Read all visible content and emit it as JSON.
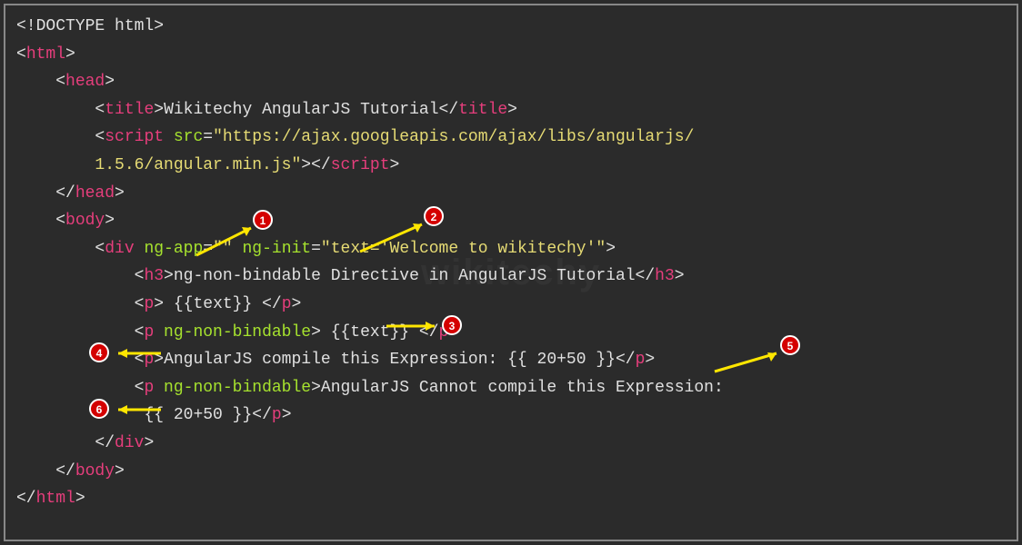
{
  "lines": {
    "l1_open": "<!DOCTYPE html>",
    "l2_open": "<",
    "l2_tag": "html",
    "l2_close": ">",
    "l3_open": "<",
    "l3_tag": "head",
    "l3_close": ">",
    "l4_open": "<",
    "l4_tag": "title",
    "l4_mid": ">",
    "l4_text": "Wikitechy AngularJS Tutorial",
    "l4_close_open": "</",
    "l4_close": ">",
    "l5_open": "<",
    "l5_tag": "script",
    "l5_attr": " src",
    "l5_eq": "=",
    "l5_val": "\"https://ajax.googleapis.com/ajax/libs/angularjs/",
    "l6_val": "1.5.6/angular.min.js\"",
    "l6_mid": ">",
    "l6_close_open": "</",
    "l6_close_tag": "script",
    "l6_close": ">",
    "l7_open": "</",
    "l7_tag": "head",
    "l7_close": ">",
    "l8_open": "<",
    "l8_tag": "body",
    "l8_close": ">",
    "l9_open": "<",
    "l9_tag": "div",
    "l9_attr1": " ng-app",
    "l9_eq1": "=",
    "l9_val1": "\"\"",
    "l9_attr2": " ng-init",
    "l9_eq2": "=",
    "l9_val2": "\"text='Welcome to wikitechy'\"",
    "l9_close": ">",
    "l10_open": "<",
    "l10_tag": "h3",
    "l10_mid": ">",
    "l10_text": "ng-non-bindable Directive in AngularJS Tutorial",
    "l10_close_open": "</",
    "l10_close": ">",
    "l11_open": "<",
    "l11_tag": "p",
    "l11_mid": ">",
    "l11_text": " {{text}} ",
    "l11_close_open": "</",
    "l11_close": ">",
    "l12_open": "<",
    "l12_tag": "p",
    "l12_attr": " ng-non-bindable",
    "l12_mid": ">",
    "l12_text": " {{text}} ",
    "l12_close_open": "</",
    "l12_close": ">",
    "l13_open": "<",
    "l13_tag": "p",
    "l13_mid": ">",
    "l13_text": "AngularJS compile this Expression: {{ 20+50 }}",
    "l13_close_open": "</",
    "l13_close": ">",
    "l14_open": "<",
    "l14_tag": "p",
    "l14_attr": " ng-non-bindable",
    "l14_mid": ">",
    "l14_text": "AngularJS Cannot compile this Expression:",
    "l14_close_open": "</",
    "l14_close": ">",
    "l15_text": "{{ 20+50 }}",
    "l16_open": "</",
    "l16_tag": "div",
    "l16_close": ">",
    "l17_open": "</",
    "l17_tag": "body",
    "l17_close": ">",
    "l18_open": "</",
    "l18_tag": "html",
    "l18_close": ">"
  },
  "annotations": {
    "a1": "1",
    "a2": "2",
    "a3": "3",
    "a4": "4",
    "a5": "5",
    "a6": "6"
  },
  "watermark": "wikitechy"
}
